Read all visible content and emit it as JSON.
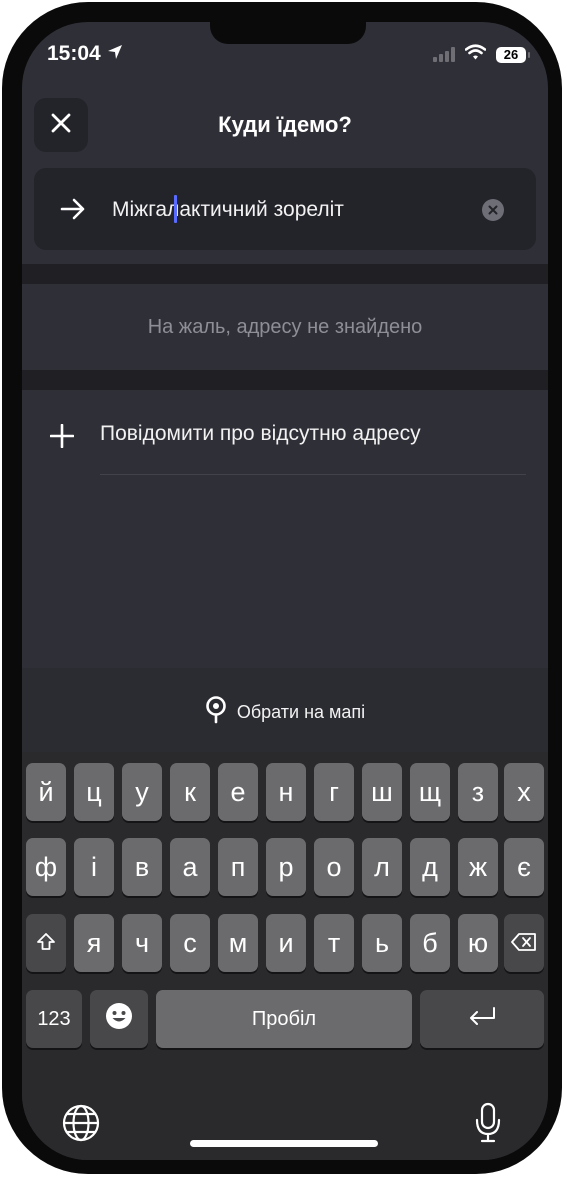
{
  "status_bar": {
    "time": "15:04",
    "battery": "26"
  },
  "header": {
    "title": "Куди їдемо?"
  },
  "search": {
    "value": "Міжгалактичний зореліт"
  },
  "results": {
    "empty_message": "На жаль, адресу не знайдено"
  },
  "actions": {
    "report_missing_label": "Повідомити про відсутню адресу"
  },
  "map_picker": {
    "label": "Обрати на мапі"
  },
  "keyboard": {
    "row1": [
      "й",
      "ц",
      "у",
      "к",
      "е",
      "н",
      "г",
      "ш",
      "щ",
      "з",
      "х"
    ],
    "row2": [
      "ф",
      "і",
      "в",
      "а",
      "п",
      "р",
      "о",
      "л",
      "д",
      "ж",
      "є"
    ],
    "row3": [
      "я",
      "ч",
      "с",
      "м",
      "и",
      "т",
      "ь",
      "б",
      "ю"
    ],
    "numbers_label": "123",
    "space_label": "Пробіл"
  },
  "icons": [
    "location-arrow-icon",
    "cellular-signal-icon",
    "wifi-icon",
    "battery-icon",
    "close-icon",
    "arrow-right-icon",
    "clear-icon",
    "plus-icon",
    "map-pin-icon",
    "shift-icon",
    "backspace-icon",
    "emoji-icon",
    "return-icon",
    "globe-icon",
    "microphone-icon"
  ],
  "colors": {
    "background": "#2f2f37",
    "panel": "#23232a",
    "cursor": "#5a6bff",
    "muted_text": "#8e8e96"
  }
}
